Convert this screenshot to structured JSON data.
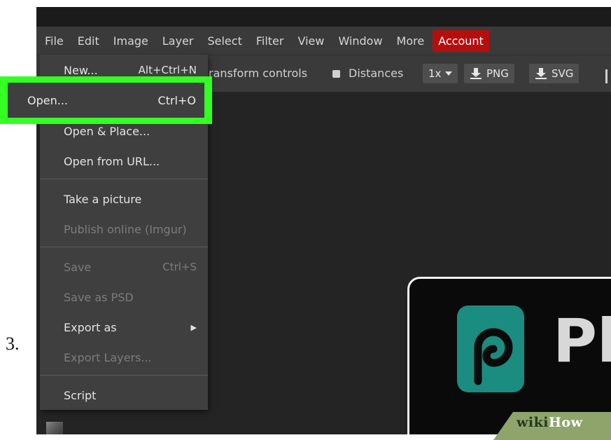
{
  "step_number": "3.",
  "menubar": {
    "items": [
      "File",
      "Edit",
      "Image",
      "Layer",
      "Select",
      "Filter",
      "View",
      "Window",
      "More"
    ],
    "account_label": "Account",
    "account_color": "#b40f0f"
  },
  "toolbar": {
    "transform_label": "ransform controls",
    "distances_label": "Distances",
    "zoom_label": "1x",
    "png_label": "PNG",
    "svg_label": "SVG"
  },
  "file_menu": {
    "new_label": "New...",
    "new_shortcut": "Alt+Ctrl+N",
    "open_label": "Open...",
    "open_shortcut": "Ctrl+O",
    "open_place_label": "Open & Place...",
    "open_url_label": "Open from URL...",
    "take_picture_label": "Take a picture",
    "publish_label": "Publish online (Imgur)",
    "save_label": "Save",
    "save_shortcut": "Ctrl+S",
    "save_psd_label": "Save as PSD",
    "export_as_label": "Export as",
    "export_layers_label": "Export Layers...",
    "script_label": "Script"
  },
  "canvas": {
    "logo_text": "Pl",
    "logo_color": "#1b8c80"
  },
  "highlight_color": "#33ff22",
  "watermark": {
    "wiki": "wiki",
    "how": "How"
  }
}
